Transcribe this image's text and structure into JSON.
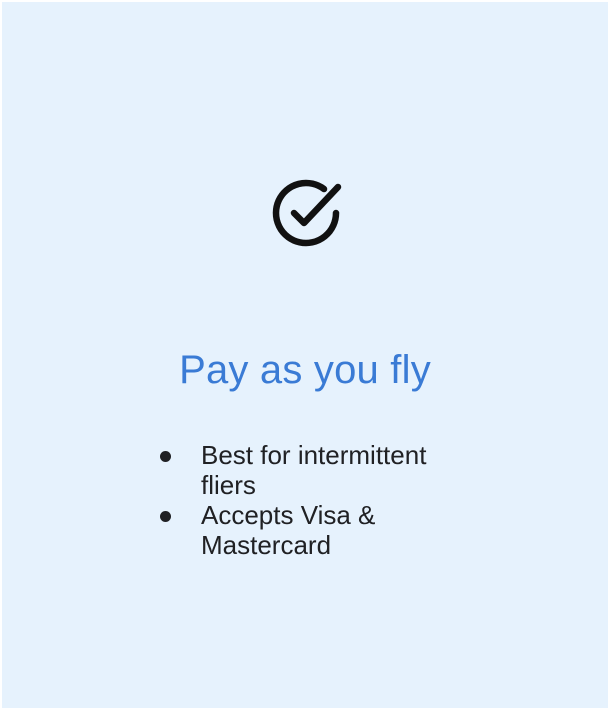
{
  "plan_card": {
    "icon": "check-circle-icon",
    "title": "Pay as you fly",
    "title_color": "#3a7bd5",
    "background_color": "#e6f2fd",
    "features": [
      "Best for intermittent fliers",
      "Accepts Visa & Mastercard"
    ]
  }
}
